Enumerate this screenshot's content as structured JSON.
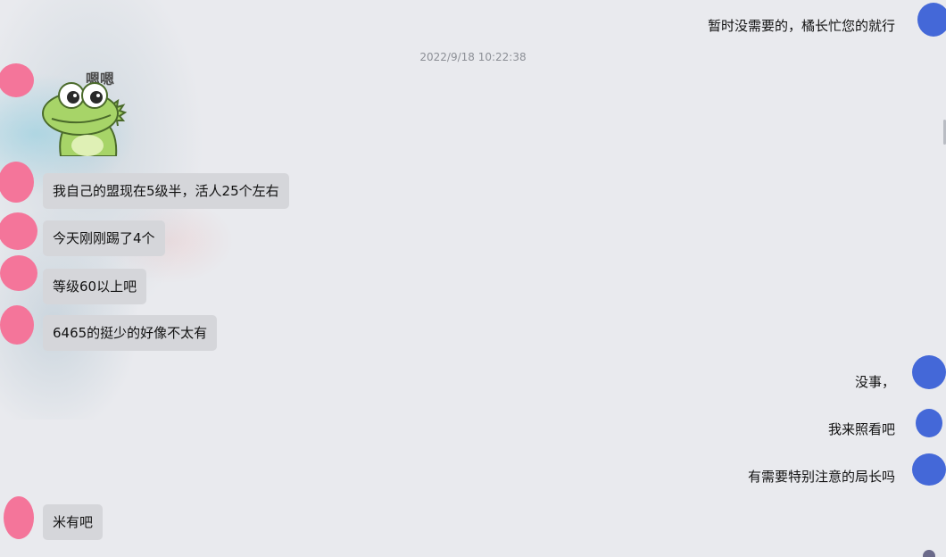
{
  "timestamp": "2022/9/18 10:22:38",
  "sticker": {
    "text": "嗯嗯",
    "name": "frog-sticker"
  },
  "messages_right": [
    {
      "text": "暂时没需要的，橘长忙您的就行"
    },
    {
      "text": "没事，"
    },
    {
      "text": "我来照看吧"
    },
    {
      "text": "有需要特别注意的局长吗"
    }
  ],
  "messages_left": [
    {
      "text": "我自己的盟现在5级半，活人25个左右"
    },
    {
      "text": "今天刚刚踢了4个"
    },
    {
      "text": "等级60以上吧"
    },
    {
      "text": "6465的挺少的好像不太有"
    },
    {
      "text": "米有吧"
    }
  ],
  "colors": {
    "background": "#e9eaee",
    "bubble": "#d5d6da",
    "avatar_left": "#f4759a",
    "avatar_right": "#4468d8"
  }
}
